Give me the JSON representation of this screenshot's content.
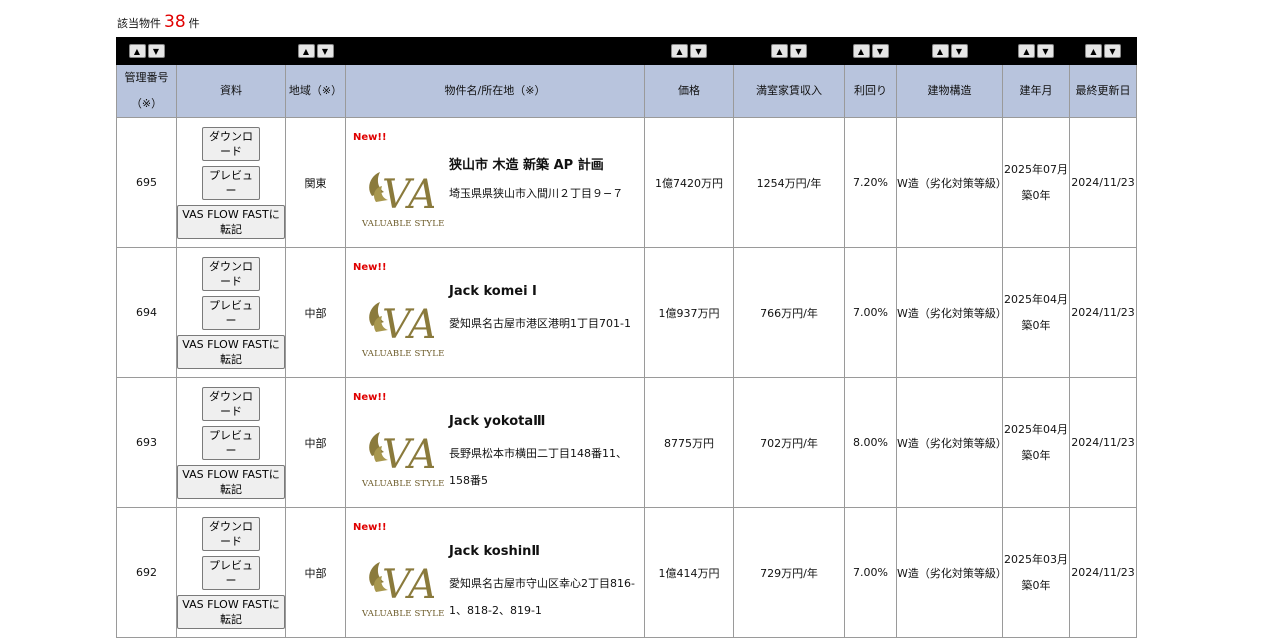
{
  "summary": {
    "prefix": "該当物件",
    "count": "38",
    "suffix": "件"
  },
  "sort_controls": {
    "up": "▲",
    "down": "▼"
  },
  "headers": {
    "id": "管理番号（※）",
    "docs": "資料",
    "region": "地域（※）",
    "property": "物件名/所在地（※）",
    "price": "価格",
    "income": "満室家賃収入",
    "yield": "利回り",
    "structure": "建物構造",
    "built": "建年月",
    "updated": "最終更新日"
  },
  "buttons": {
    "download": "ダウンロード",
    "preview": "プレビュー",
    "transfer": "VAS FLOW FASTに転記"
  },
  "new_badge": "New!!",
  "logo_text": "VALUABLE STYLE",
  "logo_letters": "VAS",
  "rows": [
    {
      "id": "695",
      "region": "関東",
      "name": "狭山市 木造 新築 AP 計画",
      "address": "埼玉県県狭山市入間川２丁目９−７",
      "price": "1億7420万円",
      "income": "1254万円/年",
      "yield": "7.20%",
      "structure": "W造（劣化対策等級）",
      "built_month": "2025年07月",
      "age": "築0年",
      "updated": "2024/11/23"
    },
    {
      "id": "694",
      "region": "中部",
      "name": "Jack komei Ⅰ",
      "address": "愛知県名古屋市港区港明1丁目701-1",
      "price": "1億937万円",
      "income": "766万円/年",
      "yield": "7.00%",
      "structure": "W造（劣化対策等級）",
      "built_month": "2025年04月",
      "age": "築0年",
      "updated": "2024/11/23"
    },
    {
      "id": "693",
      "region": "中部",
      "name": "Jack yokotaⅢ",
      "address": "長野県松本市横田二丁目148番11、158番5",
      "price": "8775万円",
      "income": "702万円/年",
      "yield": "8.00%",
      "structure": "W造（劣化対策等級）",
      "built_month": "2025年04月",
      "age": "築0年",
      "updated": "2024/11/23"
    },
    {
      "id": "692",
      "region": "中部",
      "name": "Jack koshinⅡ",
      "address": "愛知県名古屋市守山区幸心2丁目816-1、818-2、819-1",
      "price": "1億414万円",
      "income": "729万円/年",
      "yield": "7.00%",
      "structure": "W造（劣化対策等級）",
      "built_month": "2025年03月",
      "age": "築0年",
      "updated": "2024/11/23"
    }
  ],
  "colors": {
    "header_bg": "#b8c4dd",
    "sort_bar_bg": "#000000",
    "count_color": "#e00000",
    "new_color": "#e00000",
    "logo_gold": "#8a7a3c"
  }
}
